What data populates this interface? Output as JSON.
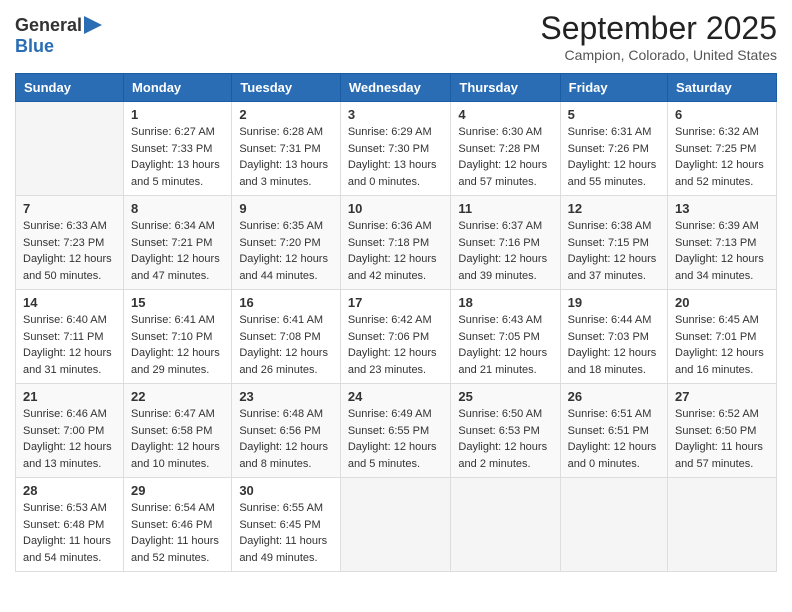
{
  "header": {
    "logo_general": "General",
    "logo_blue": "Blue",
    "month_title": "September 2025",
    "subtitle": "Campion, Colorado, United States"
  },
  "days_of_week": [
    "Sunday",
    "Monday",
    "Tuesday",
    "Wednesday",
    "Thursday",
    "Friday",
    "Saturday"
  ],
  "weeks": [
    [
      {
        "day": "",
        "content": ""
      },
      {
        "day": "1",
        "content": "Sunrise: 6:27 AM\nSunset: 7:33 PM\nDaylight: 13 hours\nand 5 minutes."
      },
      {
        "day": "2",
        "content": "Sunrise: 6:28 AM\nSunset: 7:31 PM\nDaylight: 13 hours\nand 3 minutes."
      },
      {
        "day": "3",
        "content": "Sunrise: 6:29 AM\nSunset: 7:30 PM\nDaylight: 13 hours\nand 0 minutes."
      },
      {
        "day": "4",
        "content": "Sunrise: 6:30 AM\nSunset: 7:28 PM\nDaylight: 12 hours\nand 57 minutes."
      },
      {
        "day": "5",
        "content": "Sunrise: 6:31 AM\nSunset: 7:26 PM\nDaylight: 12 hours\nand 55 minutes."
      },
      {
        "day": "6",
        "content": "Sunrise: 6:32 AM\nSunset: 7:25 PM\nDaylight: 12 hours\nand 52 minutes."
      }
    ],
    [
      {
        "day": "7",
        "content": "Sunrise: 6:33 AM\nSunset: 7:23 PM\nDaylight: 12 hours\nand 50 minutes."
      },
      {
        "day": "8",
        "content": "Sunrise: 6:34 AM\nSunset: 7:21 PM\nDaylight: 12 hours\nand 47 minutes."
      },
      {
        "day": "9",
        "content": "Sunrise: 6:35 AM\nSunset: 7:20 PM\nDaylight: 12 hours\nand 44 minutes."
      },
      {
        "day": "10",
        "content": "Sunrise: 6:36 AM\nSunset: 7:18 PM\nDaylight: 12 hours\nand 42 minutes."
      },
      {
        "day": "11",
        "content": "Sunrise: 6:37 AM\nSunset: 7:16 PM\nDaylight: 12 hours\nand 39 minutes."
      },
      {
        "day": "12",
        "content": "Sunrise: 6:38 AM\nSunset: 7:15 PM\nDaylight: 12 hours\nand 37 minutes."
      },
      {
        "day": "13",
        "content": "Sunrise: 6:39 AM\nSunset: 7:13 PM\nDaylight: 12 hours\nand 34 minutes."
      }
    ],
    [
      {
        "day": "14",
        "content": "Sunrise: 6:40 AM\nSunset: 7:11 PM\nDaylight: 12 hours\nand 31 minutes."
      },
      {
        "day": "15",
        "content": "Sunrise: 6:41 AM\nSunset: 7:10 PM\nDaylight: 12 hours\nand 29 minutes."
      },
      {
        "day": "16",
        "content": "Sunrise: 6:41 AM\nSunset: 7:08 PM\nDaylight: 12 hours\nand 26 minutes."
      },
      {
        "day": "17",
        "content": "Sunrise: 6:42 AM\nSunset: 7:06 PM\nDaylight: 12 hours\nand 23 minutes."
      },
      {
        "day": "18",
        "content": "Sunrise: 6:43 AM\nSunset: 7:05 PM\nDaylight: 12 hours\nand 21 minutes."
      },
      {
        "day": "19",
        "content": "Sunrise: 6:44 AM\nSunset: 7:03 PM\nDaylight: 12 hours\nand 18 minutes."
      },
      {
        "day": "20",
        "content": "Sunrise: 6:45 AM\nSunset: 7:01 PM\nDaylight: 12 hours\nand 16 minutes."
      }
    ],
    [
      {
        "day": "21",
        "content": "Sunrise: 6:46 AM\nSunset: 7:00 PM\nDaylight: 12 hours\nand 13 minutes."
      },
      {
        "day": "22",
        "content": "Sunrise: 6:47 AM\nSunset: 6:58 PM\nDaylight: 12 hours\nand 10 minutes."
      },
      {
        "day": "23",
        "content": "Sunrise: 6:48 AM\nSunset: 6:56 PM\nDaylight: 12 hours\nand 8 minutes."
      },
      {
        "day": "24",
        "content": "Sunrise: 6:49 AM\nSunset: 6:55 PM\nDaylight: 12 hours\nand 5 minutes."
      },
      {
        "day": "25",
        "content": "Sunrise: 6:50 AM\nSunset: 6:53 PM\nDaylight: 12 hours\nand 2 minutes."
      },
      {
        "day": "26",
        "content": "Sunrise: 6:51 AM\nSunset: 6:51 PM\nDaylight: 12 hours\nand 0 minutes."
      },
      {
        "day": "27",
        "content": "Sunrise: 6:52 AM\nSunset: 6:50 PM\nDaylight: 11 hours\nand 57 minutes."
      }
    ],
    [
      {
        "day": "28",
        "content": "Sunrise: 6:53 AM\nSunset: 6:48 PM\nDaylight: 11 hours\nand 54 minutes."
      },
      {
        "day": "29",
        "content": "Sunrise: 6:54 AM\nSunset: 6:46 PM\nDaylight: 11 hours\nand 52 minutes."
      },
      {
        "day": "30",
        "content": "Sunrise: 6:55 AM\nSunset: 6:45 PM\nDaylight: 11 hours\nand 49 minutes."
      },
      {
        "day": "",
        "content": ""
      },
      {
        "day": "",
        "content": ""
      },
      {
        "day": "",
        "content": ""
      },
      {
        "day": "",
        "content": ""
      }
    ]
  ]
}
